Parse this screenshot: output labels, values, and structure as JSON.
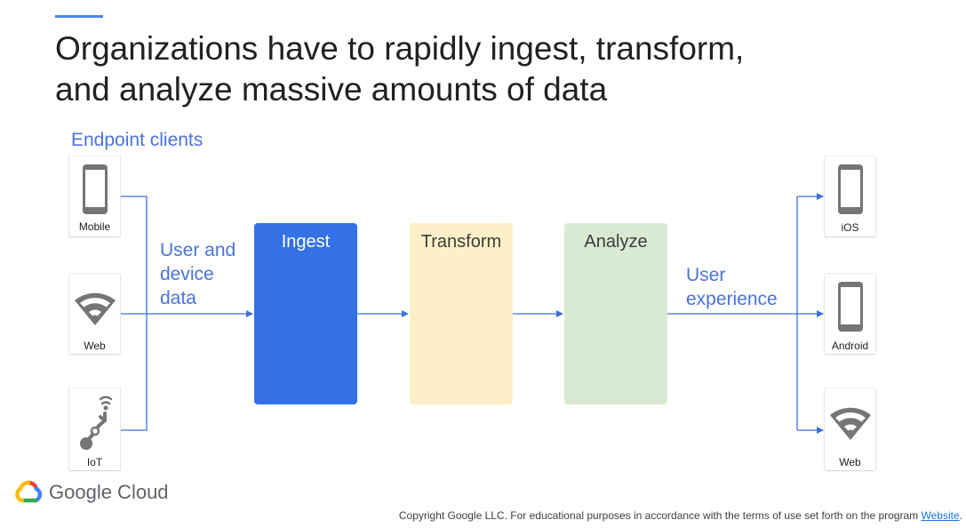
{
  "title": {
    "line1": "Organizations have to rapidly ingest, transform,",
    "line2": "and analyze massive amounts of data"
  },
  "left_section": {
    "heading": "Endpoint clients",
    "clients": [
      {
        "label": "Mobile",
        "icon": "phone-icon"
      },
      {
        "label": "Web",
        "icon": "wifi-icon"
      },
      {
        "label": "IoT",
        "icon": "iot-icon"
      }
    ],
    "flow_label": {
      "line1": "User and",
      "line2": "device",
      "line3": "data"
    }
  },
  "stages": [
    {
      "label": "Ingest",
      "color": "#3471e6"
    },
    {
      "label": "Transform",
      "color": "#fdf0c8"
    },
    {
      "label": "Analyze",
      "color": "#d9ead3"
    }
  ],
  "right_section": {
    "flow_label": {
      "line1": "User",
      "line2": "experience"
    },
    "targets": [
      {
        "label": "iOS",
        "icon": "phone-icon"
      },
      {
        "label": "Android",
        "icon": "phone-icon"
      },
      {
        "label": "Web",
        "icon": "wifi-icon"
      }
    ]
  },
  "colors": {
    "accent": "#4a74d8",
    "line": "#3d6fd8"
  },
  "brand": {
    "name": "Google Cloud"
  },
  "footer": {
    "text": "Copyright Google LLC. For educational purposes in accordance with the terms of use set forth on the program ",
    "link_text": "Website",
    "end": "."
  }
}
